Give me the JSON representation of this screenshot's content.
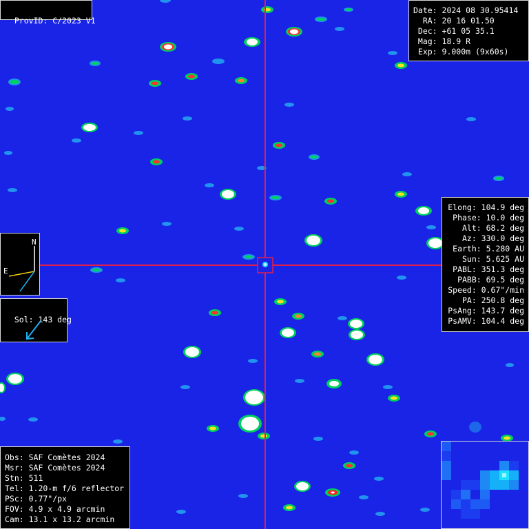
{
  "provid": "ProvID: C/2023 V1",
  "ephemeris": {
    "date": "Date: 2024 08 30.95414",
    "ra": "  RA: 20 16 01.50",
    "dec": " Dec: +61 05 35.1",
    "mag": " Mag: 18.9 R",
    "exp": " Exp: 9.000m (9x60s)"
  },
  "geometry": [
    "Elong: 104.9 deg",
    "Phase: 10.0 deg",
    "Alt: 68.2 deg",
    "Az: 330.0 deg",
    "Earth: 5.280 AU",
    "Sun: 5.625 AU",
    "PABL: 351.3 deg",
    "PABB: 69.5 deg",
    "Speed: 0.67\"/min",
    "PA: 250.8 deg",
    "PsAng: 143.7 deg",
    "PsAMV: 104.4 deg"
  ],
  "compass": {
    "north": "N",
    "east": "E"
  },
  "sol": "Sol: 143 deg",
  "observation": [
    "Obs: SAF Comètes 2024",
    "Msr: SAF Comètes 2024",
    "Stn: 511",
    "Tel: 1.20-m f/6 reflector",
    "PSc: 0.77\"/px",
    "FOV: 4.9 x 4.9 arcmin",
    "Cam: 13.1 x 13.2 arcmin"
  ],
  "colors": {
    "sky": "#1a24e6",
    "crosshair": "#e0204a",
    "star_core": "#ffffff",
    "star_ring": "#00d060",
    "streak": "#22a8f0",
    "compass_east": "#f0d000",
    "compass_motion": "#1ab0f0"
  }
}
